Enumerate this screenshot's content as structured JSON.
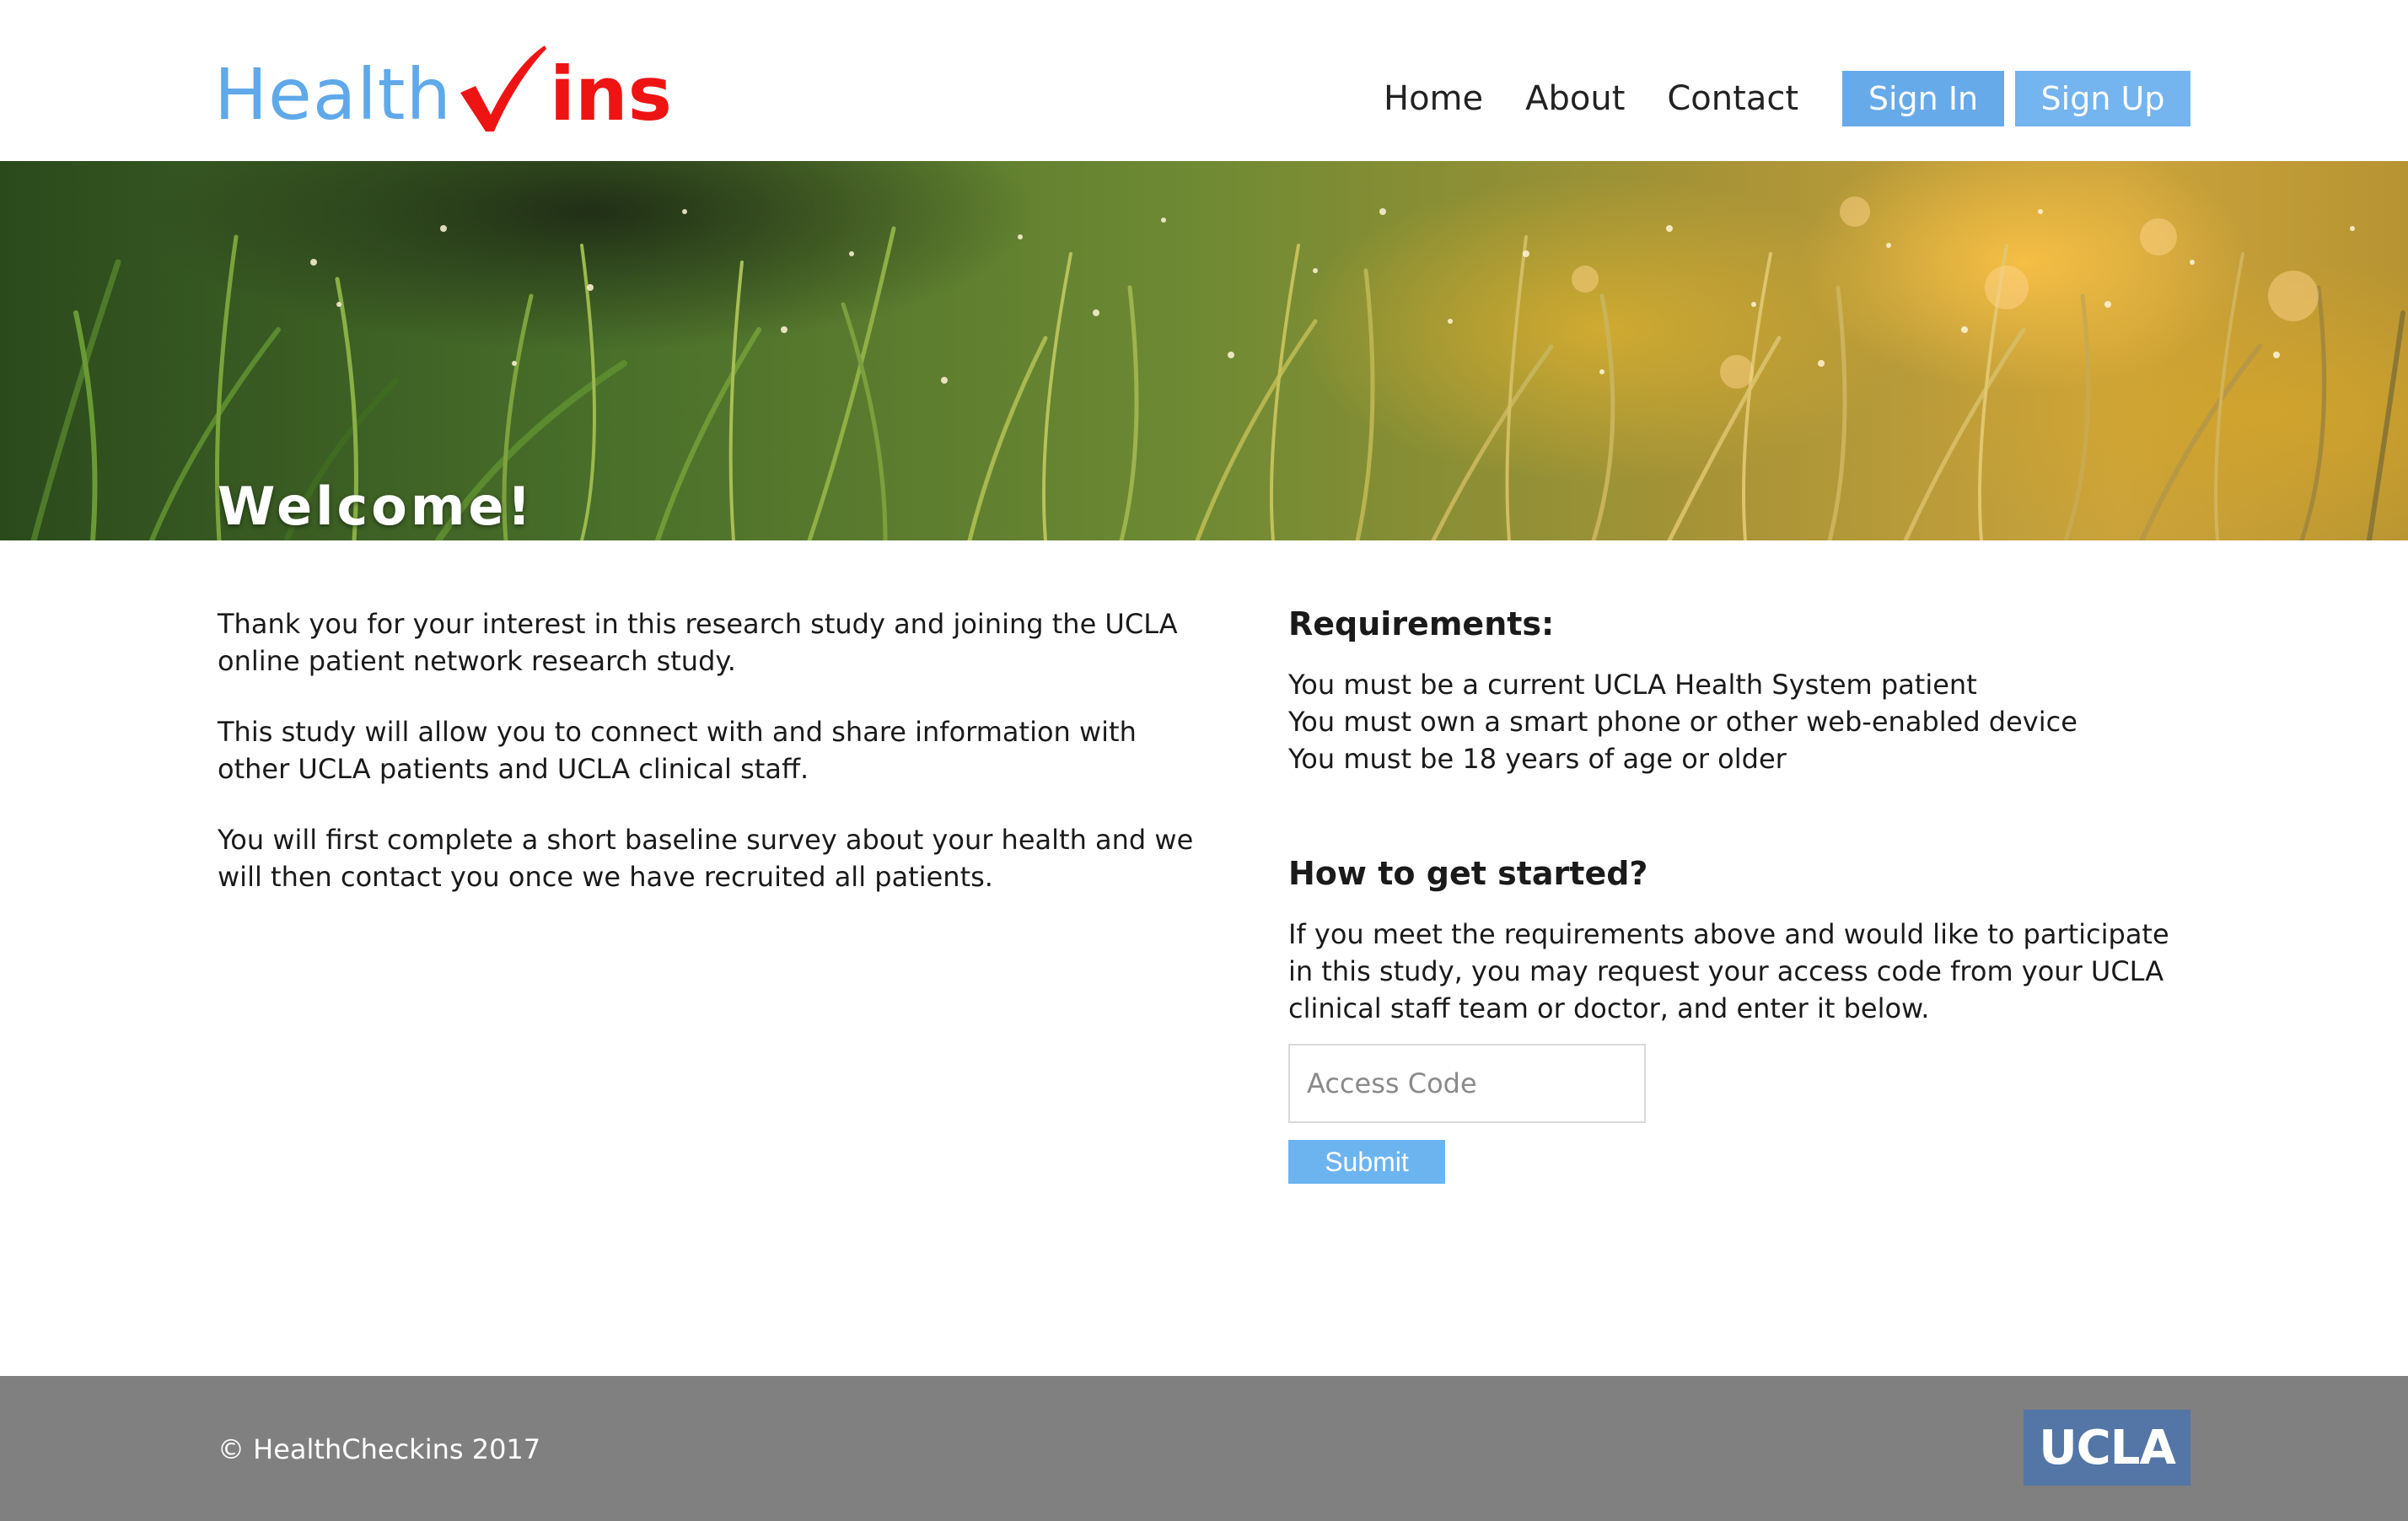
{
  "brand": {
    "name_part1": "Health",
    "name_part2": "ins",
    "check_color": "#ee1414",
    "primary_color": "#5fa9ea",
    "accent_color": "#ee1414"
  },
  "nav": {
    "items": [
      "Home",
      "About",
      "Contact"
    ],
    "sign_in": "Sign In",
    "sign_up": "Sign Up"
  },
  "hero": {
    "title": "Welcome!"
  },
  "intro": {
    "paragraphs": [
      "Thank you for your interest in this research study and joining the UCLA online patient network research study.",
      "This study will allow you to connect with and share information with other UCLA patients and UCLA clinical staff.",
      "You will first complete a short baseline survey about your health and we will then contact you once we have recruited all patients."
    ]
  },
  "requirements": {
    "heading": "Requirements:",
    "items": [
      "You must be a current UCLA Health System patient",
      "You must own a smart phone or other web-enabled device",
      "You must be 18 years of age or older"
    ]
  },
  "get_started": {
    "heading": "How to get started?",
    "text": "If you meet the requirements above and would like to participate in this study, you may request your access code from your UCLA clinical staff team or doctor, and enter it below.",
    "input_placeholder": "Access Code",
    "input_value": "",
    "submit_label": "Submit"
  },
  "footer": {
    "copyright": "© HealthCheckins 2017",
    "logo_text": "UCLA"
  }
}
